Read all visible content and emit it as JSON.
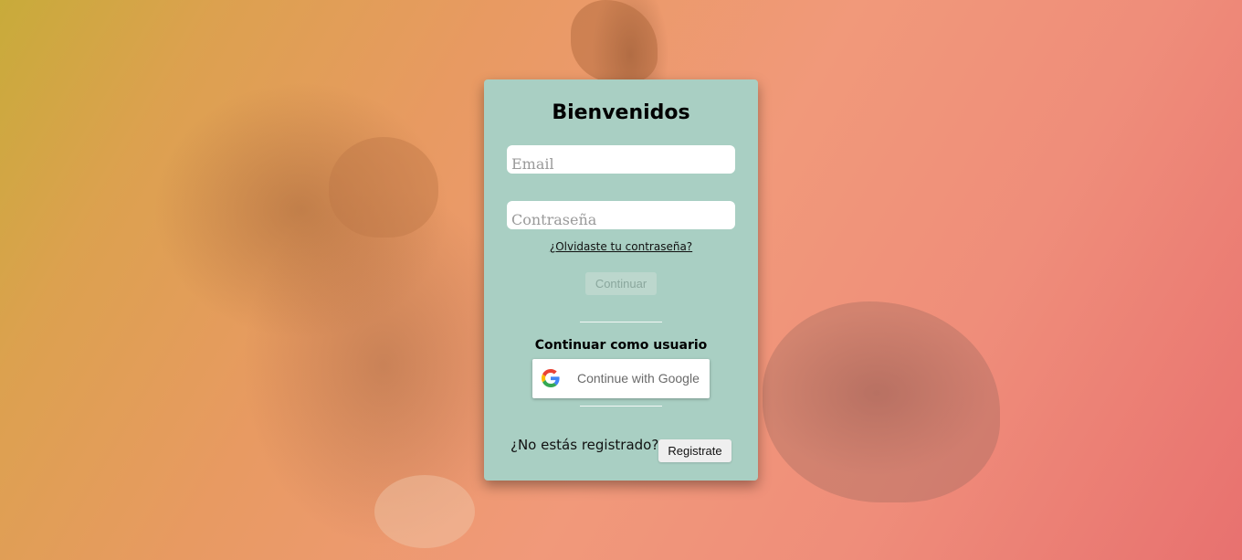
{
  "login": {
    "title": "Bienvenidos",
    "email_placeholder": "Email",
    "password_placeholder": "Contraseña",
    "forgot_password": "¿Olvidaste tu contraseña?",
    "continue_label": "Continuar",
    "guest_label": "Continuar como usuario",
    "google_label": "Continue with Google",
    "not_registered": "¿No estás registrado?",
    "register_label": "Registrate"
  },
  "colors": {
    "card_bg": "#a9cfc3",
    "continue_disabled_bg": "#bcd7cd",
    "google_blue": "#4285F4",
    "google_red": "#EA4335",
    "google_yellow": "#FBBC05",
    "google_green": "#34A853"
  },
  "icons": {
    "google": "google-g-logo"
  }
}
